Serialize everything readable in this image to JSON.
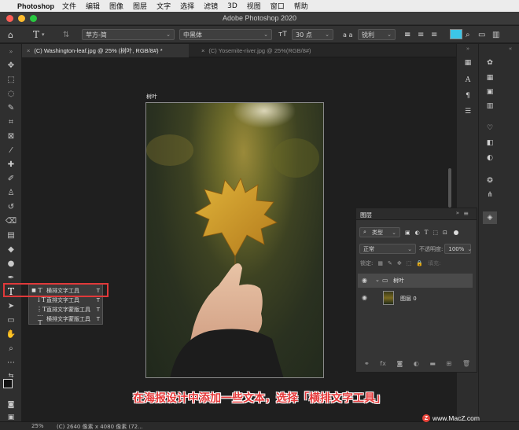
{
  "menubar": {
    "app": "Photoshop",
    "items": [
      "文件",
      "编辑",
      "图像",
      "图层",
      "文字",
      "选择",
      "滤镜",
      "3D",
      "视图",
      "窗口",
      "帮助"
    ]
  },
  "window": {
    "title": "Adobe Photoshop 2020",
    "traffic_colors": [
      "#fe5f57",
      "#febc2e",
      "#28c840"
    ]
  },
  "options": {
    "tool_glyph": "T",
    "font_family": "苹方-简",
    "font_style": "中黑体",
    "font_size": "30 点",
    "aa_label": "a a",
    "aa_value": "锐利",
    "color_swatch": "#3cc6e8"
  },
  "tabs": [
    {
      "label": "(C) Washington-leaf.jpg @ 25% (树叶, RGB/8#) *",
      "active": true
    },
    {
      "label": "(C) Yosemite-river.jpg @ 25%(RGB/8#)",
      "active": false
    }
  ],
  "canvas": {
    "artboard_label": "树叶"
  },
  "flyout": {
    "items": [
      {
        "label": "横排文字工具",
        "shortcut": "T",
        "selected": true
      },
      {
        "label": "直排文字工具",
        "shortcut": "T",
        "selected": false
      },
      {
        "label": "直排文字蒙版工具",
        "shortcut": "T",
        "selected": false
      },
      {
        "label": "横排文字蒙版工具",
        "shortcut": "T",
        "selected": false
      }
    ]
  },
  "layers": {
    "title": "图层",
    "filter_label": "类型",
    "blend_mode": "正常",
    "opacity_label": "不透明度:",
    "opacity_value": "100%",
    "lock_label": "锁定:",
    "fill_label": "填充:",
    "items": [
      {
        "name": "树叶",
        "type": "group"
      },
      {
        "name": "图层 0",
        "type": "image"
      }
    ]
  },
  "status": {
    "zoom": "25%",
    "info": "(C) 2640 像素 x 4080 像素 (72..."
  },
  "caption": "在海报设计中添加一些文本，选择「横排文字工具」",
  "watermark": "www.MacZ.com"
}
